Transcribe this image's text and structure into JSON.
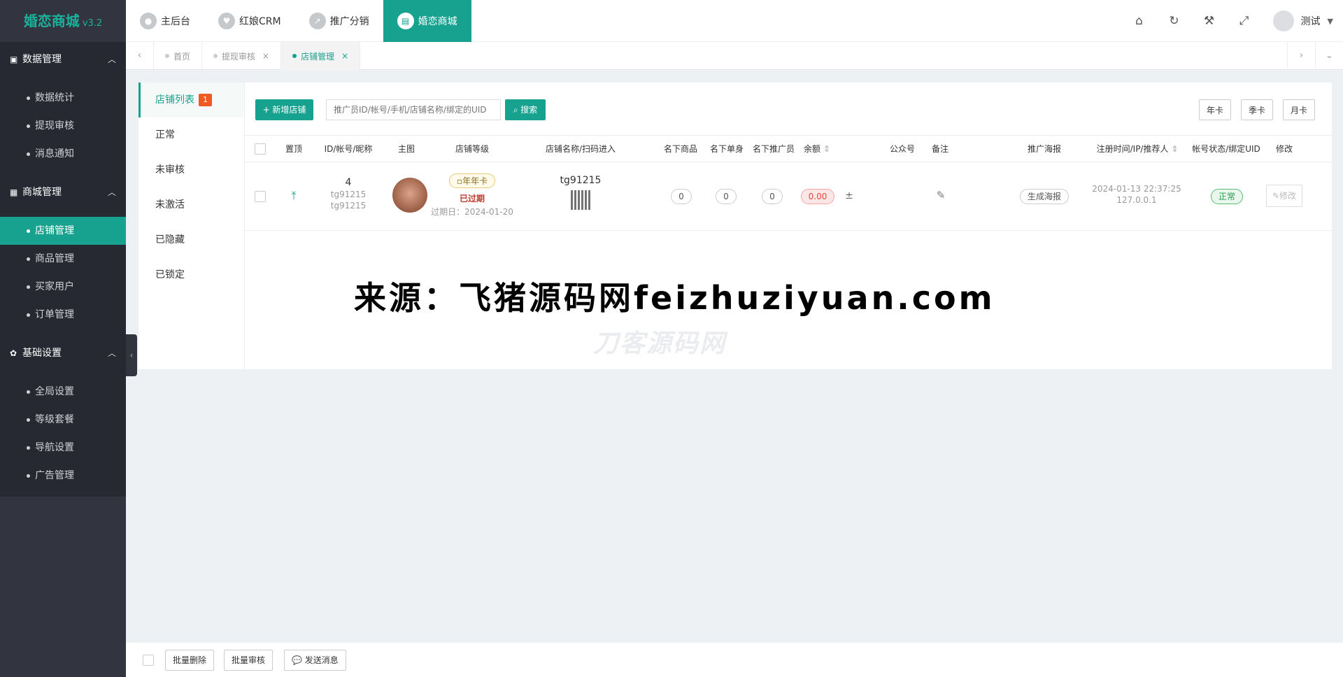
{
  "brand": {
    "name": "婚恋商城",
    "version": "v3.2"
  },
  "sidebar": {
    "groups": [
      {
        "label": "数据管理",
        "items": [
          "数据统计",
          "提现审核",
          "消息通知"
        ]
      },
      {
        "label": "商城管理",
        "items": [
          "店铺管理",
          "商品管理",
          "买家用户",
          "订单管理"
        ]
      },
      {
        "label": "基础设置",
        "items": [
          "全局设置",
          "等级套餐",
          "导航设置",
          "广告管理"
        ]
      }
    ]
  },
  "topbar": {
    "modules": [
      "主后台",
      "红娘CRM",
      "推广分销",
      "婚恋商城"
    ],
    "user": "测试"
  },
  "tabs": [
    {
      "label": "首页",
      "closable": false
    },
    {
      "label": "提现审核",
      "closable": true
    },
    {
      "label": "店铺管理",
      "closable": true
    }
  ],
  "left_nav": {
    "items": [
      "店铺列表",
      "正常",
      "未审核",
      "未激活",
      "已隐藏",
      "已锁定"
    ],
    "badge": "1"
  },
  "toolbar": {
    "add_label": "+ 新增店铺",
    "search_placeholder": "推广员ID/帐号/手机/店铺名称/绑定的UID",
    "search_label": "搜索",
    "filters": [
      "年卡",
      "季卡",
      "月卡"
    ]
  },
  "table": {
    "headers": [
      "置顶",
      "ID/帐号/昵称",
      "主图",
      "店铺等级",
      "店铺名称/扫码进入",
      "名下商品",
      "名下单身",
      "名下推广员",
      "余额",
      "公众号",
      "备注",
      "推广海报",
      "注册时间/IP/推荐人",
      "帐号状态/绑定UID",
      "修改"
    ],
    "row": {
      "id": "4",
      "account": "tg91215",
      "nickname": "tg91215",
      "level_img_alt": "年年卡",
      "level_status": "已过期",
      "expire": "过期日：2024-01-20",
      "shop_name": "tg91215",
      "goods": "0",
      "singles": "0",
      "promoters": "0",
      "balance": "0.00",
      "balance_adj": "±",
      "poster": "生成海报",
      "reg_time": "2024-01-13 22:37:25",
      "ip": "127.0.0.1",
      "status": "正常",
      "edit": "修改"
    }
  },
  "watermark": {
    "source": "来源：飞猪源码网feizhuziyuan.com",
    "faint": "刀客源码网"
  },
  "footer": {
    "buttons": [
      "批量删除",
      "批量审核",
      "发送消息"
    ]
  },
  "colors": {
    "accent": "#17a290",
    "sidebar": "#32353f",
    "badge": "#f05a22"
  }
}
